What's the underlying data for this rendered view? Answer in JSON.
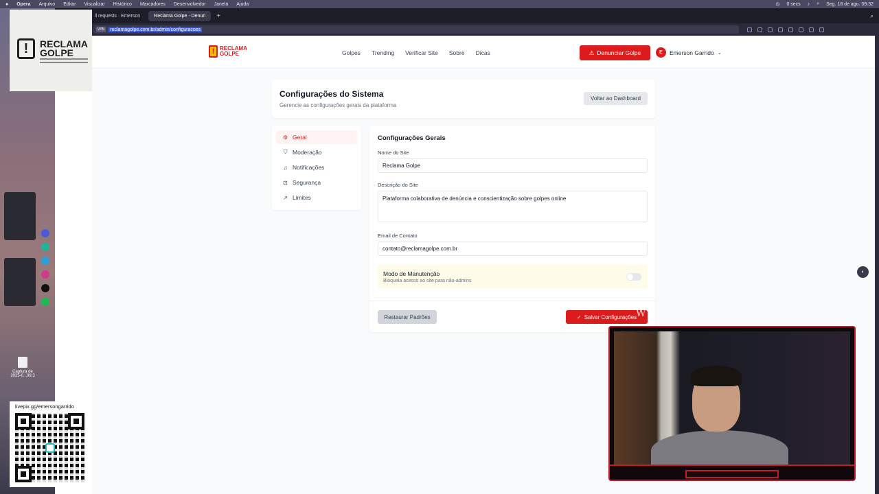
{
  "menubar": {
    "app": "Opera",
    "items": [
      "Arquivo",
      "Editar",
      "Visualizar",
      "Histórico",
      "Marcadores",
      "Desenvolvedor",
      "Janela",
      "Ajuda"
    ],
    "timer": "0 secs",
    "datetime": "Seg. 18 de ago. 09:32"
  },
  "browser": {
    "tabs": [
      {
        "label": "ll requests · Emerson"
      },
      {
        "label": "Reclama Golpe - Denun"
      }
    ],
    "vpn": "VPN",
    "url": "reclamagolpe.com.br/admin/configuracoes"
  },
  "desktop": {
    "file_label_1": "Captura de",
    "file_label_2": "2025-0...09.3"
  },
  "site": {
    "logo_line1": "RECLAMA",
    "logo_line2": "GOLPE",
    "nav": [
      "Golpes",
      "Trending",
      "Verificar Site",
      "Sobre",
      "Dicas"
    ],
    "report_button": "Denunciar Golpe",
    "user_initial": "E",
    "user_name": "Emerson Garrido"
  },
  "header": {
    "title": "Configurações do Sistema",
    "subtitle": "Gerencie as configurações gerais da plataforma",
    "back_button": "Voltar ao Dashboard"
  },
  "sidebar": {
    "items": [
      {
        "label": "Geral",
        "icon": "gear-icon",
        "active": true
      },
      {
        "label": "Moderação",
        "icon": "shield-icon",
        "active": false
      },
      {
        "label": "Notificações",
        "icon": "bell-icon",
        "active": false
      },
      {
        "label": "Segurança",
        "icon": "lock-icon",
        "active": false
      },
      {
        "label": "Limites",
        "icon": "trend-icon",
        "active": false
      }
    ]
  },
  "form": {
    "title": "Configurações Gerais",
    "site_name_label": "Nome do Site",
    "site_name_value": "Reclama Golpe",
    "site_desc_label": "Descrição do Site",
    "site_desc_value": "Plataforma colaborativa de denúncia e conscientização sobre golpes online",
    "email_label": "Email de Contato",
    "email_value": "contato@reclamagolpe.com.br",
    "maintenance_title": "Modo de Manutenção",
    "maintenance_desc": "Bloqueia acesso ao site para não-admins",
    "maintenance_enabled": false,
    "restore_button": "Restaurar Padrões",
    "save_button": "Salvar Configurações"
  },
  "overlay": {
    "logo_line1": "RECLAMA",
    "logo_line2": "GOLPE",
    "qr_caption": "livepix.gg/emersongarrido"
  },
  "colors": {
    "brand_red": "#dc1c1c",
    "active_bg": "#fef2f2",
    "maintenance_bg": "#fefce8"
  }
}
